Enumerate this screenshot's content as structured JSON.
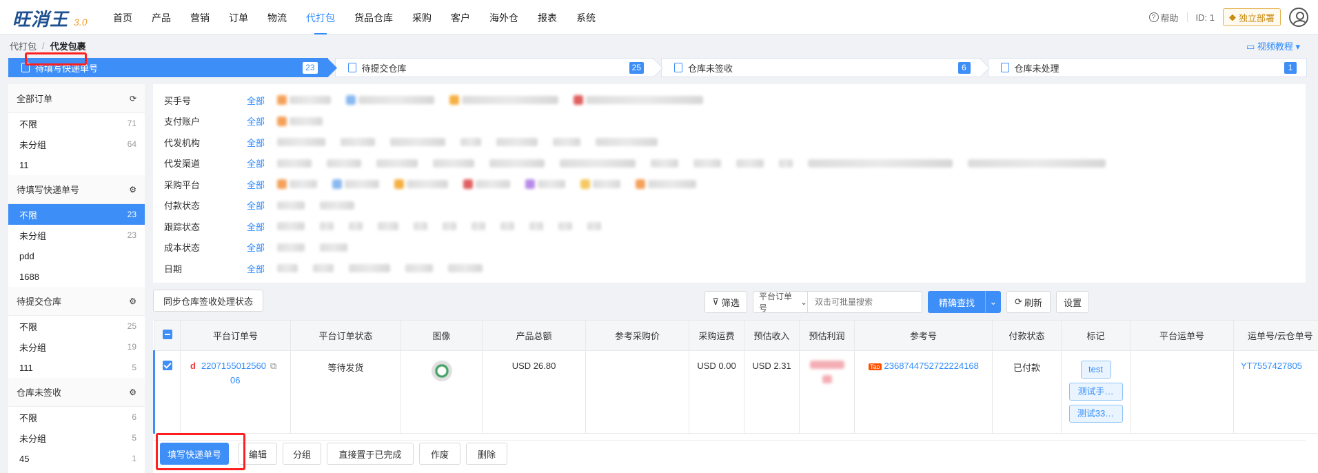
{
  "app": {
    "logo": "旺消王",
    "version": "3.0"
  },
  "nav": [
    "首页",
    "产品",
    "营销",
    "订单",
    "物流",
    "代打包",
    "货品仓库",
    "采购",
    "客户",
    "海外仓",
    "报表",
    "系统"
  ],
  "nav_active_index": 5,
  "topright": {
    "help": "帮助",
    "id": "ID: 1",
    "deploy": "独立部署"
  },
  "breadcrumb": {
    "parent": "代打包",
    "current": "代发包裹"
  },
  "video_tutorial": "视频教程",
  "steps": [
    {
      "label": "待填写快递单号",
      "count": "23"
    },
    {
      "label": "待提交仓库",
      "count": "25"
    },
    {
      "label": "仓库未签收",
      "count": "6"
    },
    {
      "label": "仓库未处理",
      "count": "1"
    }
  ],
  "sidebar": {
    "groups": [
      {
        "title": "全部订单",
        "icon": "refresh-icon",
        "rows": [
          {
            "label": "不限",
            "n": "71"
          },
          {
            "label": "未分组",
            "n": "64"
          },
          {
            "label": "11",
            "n": ""
          }
        ]
      },
      {
        "title": "待填写快递单号",
        "icon": "gear-icon",
        "rows": [
          {
            "label": "不限",
            "n": "23"
          },
          {
            "label": "未分组",
            "n": "23"
          },
          {
            "label": "pdd",
            "n": ""
          },
          {
            "label": "1688",
            "n": ""
          }
        ]
      },
      {
        "title": "待提交仓库",
        "icon": "gear-icon",
        "rows": [
          {
            "label": "不限",
            "n": "25"
          },
          {
            "label": "未分组",
            "n": "19"
          },
          {
            "label": "111",
            "n": "5"
          }
        ]
      },
      {
        "title": "仓库未签收",
        "icon": "gear-icon",
        "rows": [
          {
            "label": "不限",
            "n": "6"
          },
          {
            "label": "未分组",
            "n": "5"
          },
          {
            "label": "45",
            "n": "1"
          }
        ]
      }
    ]
  },
  "filters": {
    "all": "全部",
    "rows": [
      "买手号",
      "支付账户",
      "代发机构",
      "代发渠道",
      "采购平台",
      "付款状态",
      "跟踪状态",
      "成本状态",
      "日期"
    ]
  },
  "toolbar": {
    "sync": "同步仓库签收处理状态",
    "filter": "筛选",
    "search_type": "平台订单号",
    "search_placeholder": "双击可批量搜索",
    "precise": "精确查找",
    "refresh": "刷新",
    "settings": "设置"
  },
  "table": {
    "headers": [
      "平台订单号",
      "平台订单状态",
      "图像",
      "产品总额",
      "参考采购价",
      "采购运费",
      "预估收入",
      "预估利润",
      "参考号",
      "付款状态",
      "标记",
      "平台运单号",
      "运单号/云仓单号"
    ],
    "row": {
      "order_no_1": "2207155012560",
      "order_no_2": "06",
      "status": "等待发货",
      "total": "USD 26.80",
      "purchase_price": "",
      "freight": "USD 0.00",
      "income": "USD 2.31",
      "ref_no": "2368744752722224168",
      "pay_status": "已付款",
      "tags": [
        "test",
        "测试手…",
        "测试33…"
      ],
      "platform_waybill": "",
      "waybill": "YT7557427805"
    }
  },
  "actions": [
    "填写快递单号",
    "编辑",
    "分组",
    "直接置于已完成",
    "作废",
    "删除"
  ]
}
